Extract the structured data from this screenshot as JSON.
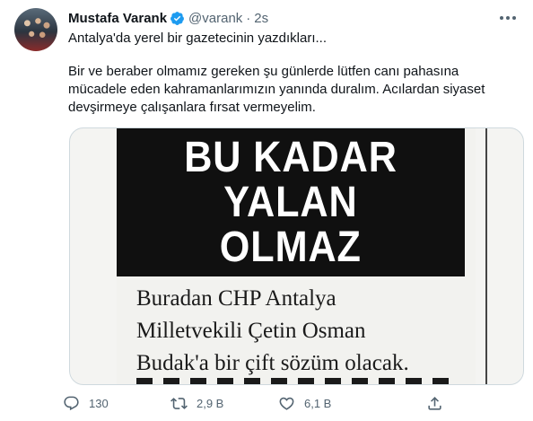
{
  "author": {
    "name": "Mustafa Varank",
    "handle": "@varank",
    "time": "2s"
  },
  "tweet": {
    "line1": "Antalya'da yerel bir gazetecinin yazdıkları...",
    "para2": "Bir ve beraber olmamız gereken şu günlerde lütfen canı pahasına mücadele eden kahramanlarımızın yanında duralım. Acılardan siyaset devşirmeye çalışanlara fırsat vermeyelim."
  },
  "media": {
    "headline": [
      "BU KADAR",
      "YALAN",
      "OLMAZ"
    ],
    "body_lines": [
      "Buradan CHP Antalya",
      "Milletvekili Çetin Osman",
      "Budak'a bir çift sözüm olacak."
    ]
  },
  "actions": {
    "reply_count": "130",
    "retweet_count": "2,9 B",
    "like_count": "6,1 B"
  },
  "icons": {
    "verified": "verified-badge-icon",
    "more": "more-icon",
    "reply": "reply-icon",
    "retweet": "retweet-icon",
    "like": "heart-icon",
    "share": "share-icon"
  },
  "colors": {
    "verified": "#1d9bf0",
    "secondary_text": "#536471",
    "border": "#cfd9de"
  }
}
